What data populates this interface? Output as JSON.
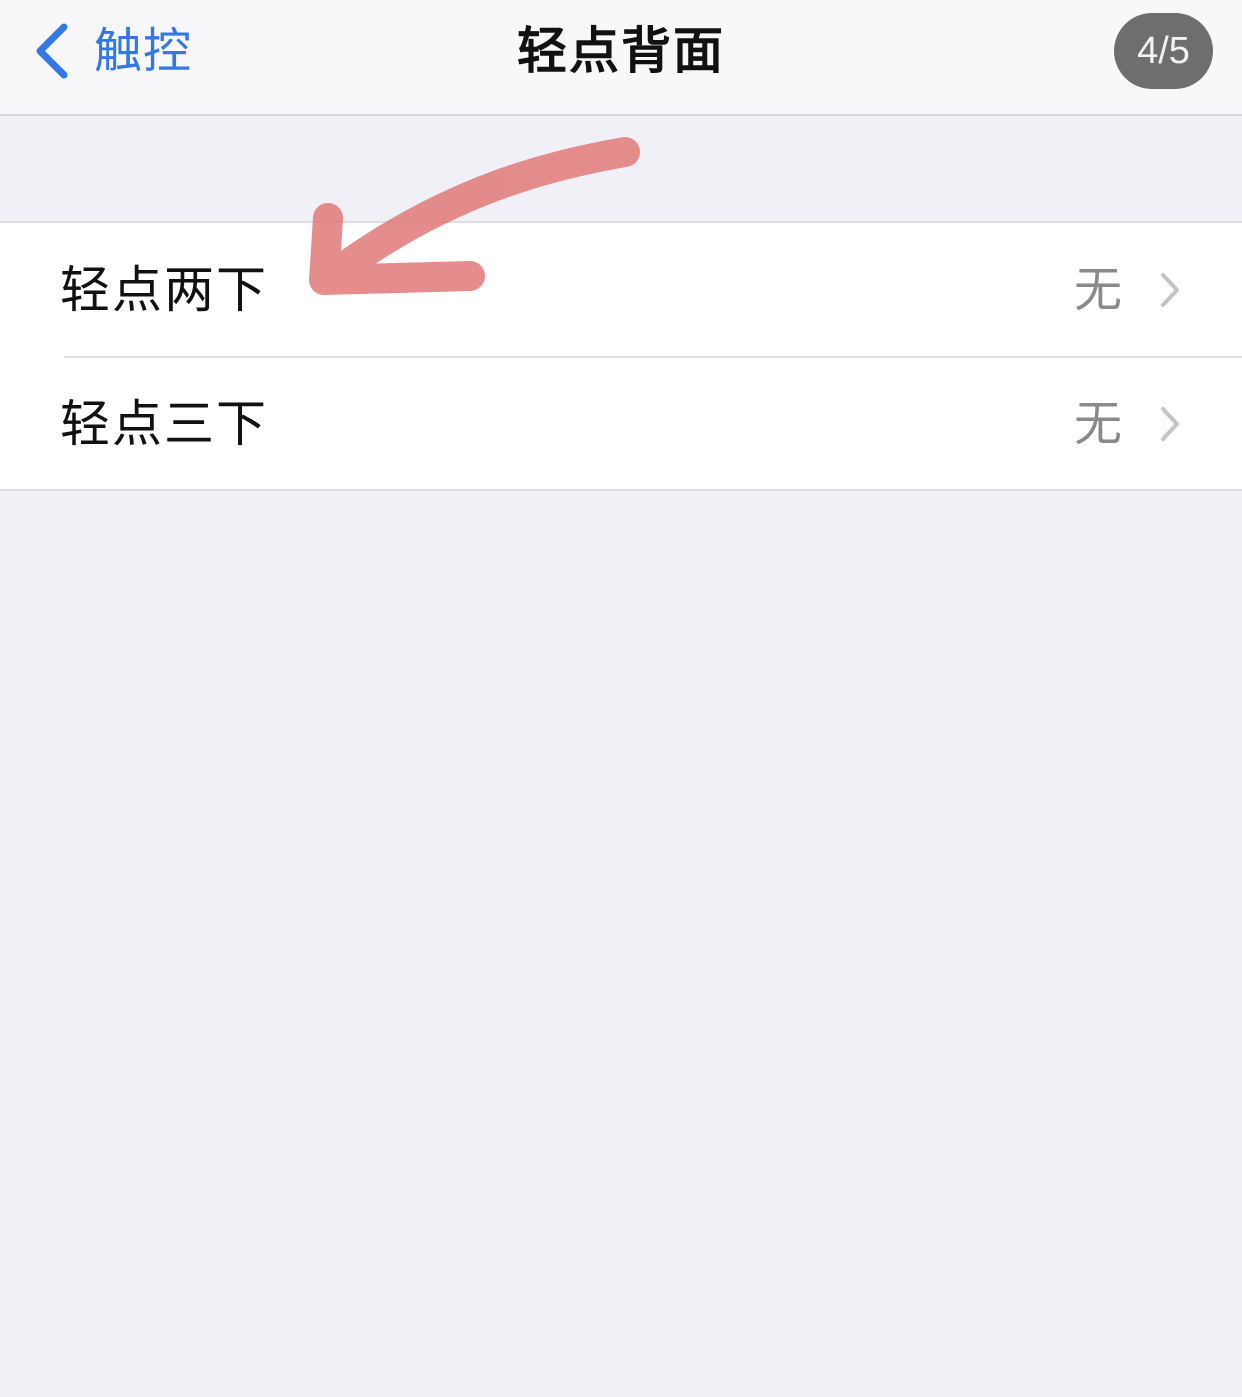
{
  "nav": {
    "back_label": "触控",
    "title": "轻点背面",
    "page_badge": "4/5",
    "accent_color": "#3478e6"
  },
  "settings": {
    "rows": [
      {
        "label": "轻点两下",
        "value": "无",
        "icon": "chevron-right-icon"
      },
      {
        "label": "轻点三下",
        "value": "无",
        "icon": "chevron-right-icon"
      }
    ]
  },
  "annotation": {
    "type": "hand-drawn-arrow",
    "color": "#e07a78",
    "points_to": "轻点两下"
  }
}
